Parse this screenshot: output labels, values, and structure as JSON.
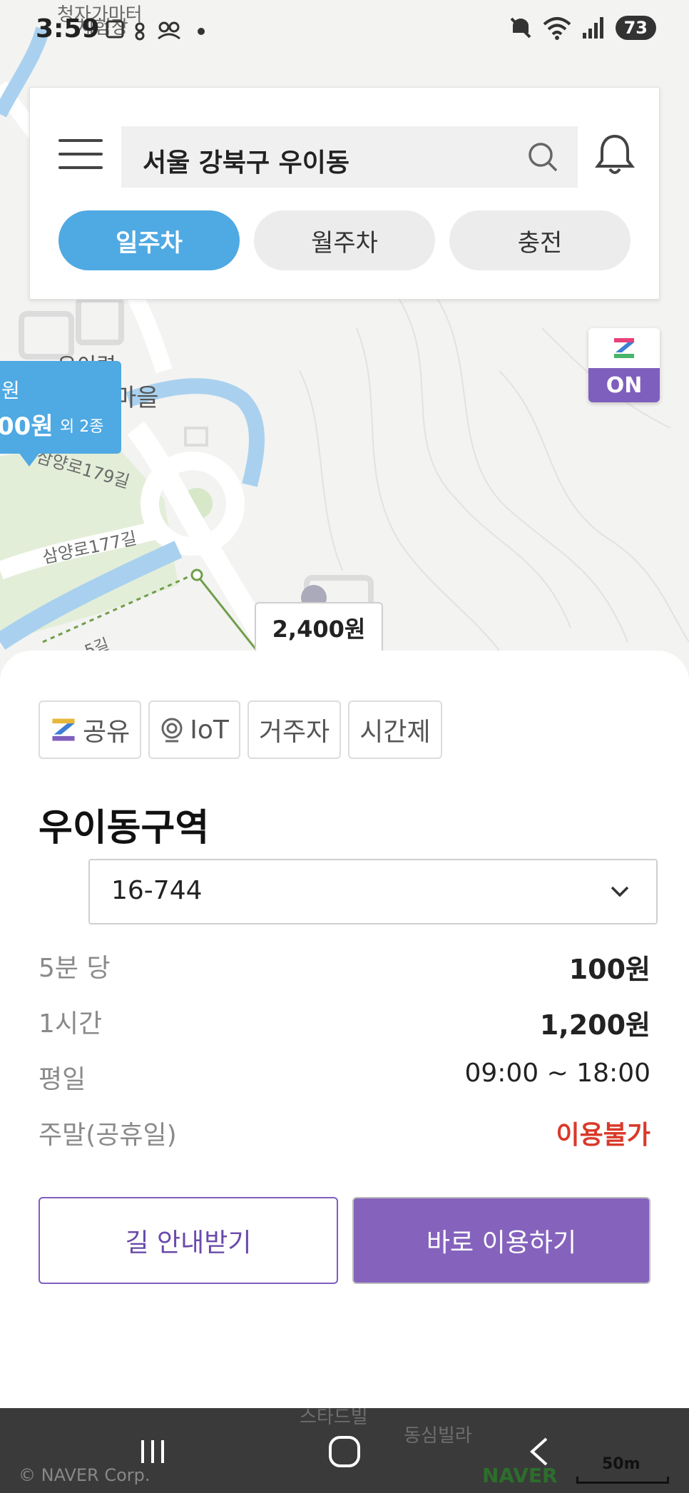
{
  "status_bar": {
    "time": "3:59",
    "battery": "73"
  },
  "map": {
    "labels": {
      "top_label_1": "청자가마터",
      "top_label_2": "체험장",
      "area_1": "우이령",
      "area_2": "마을",
      "road_1": "삼양로179길",
      "road_2": "삼양로177길",
      "road_3": "5길",
      "bottom_label_1": "스타드빌",
      "bottom_label_2": "동심빌라"
    },
    "bubble": {
      "line1": "원",
      "price": "00원",
      "extra": "외 2종"
    },
    "price_marker": "2,400원",
    "scale": "50m",
    "naver": "NAVER",
    "copyright": "© NAVER Corp."
  },
  "search": {
    "query": "서울 강북구 우이동",
    "tabs": [
      {
        "label": "일주차",
        "active": true
      },
      {
        "label": "월주차",
        "active": false
      },
      {
        "label": "충전",
        "active": false
      }
    ]
  },
  "zon_badge": {
    "label": "ON"
  },
  "sheet": {
    "tags": [
      "공유",
      "IoT",
      "거주자",
      "시간제"
    ],
    "zone_title": "우이동구역",
    "selected_lot": "16-744",
    "rows": [
      {
        "key": "5분 당",
        "value": "100원",
        "style": "bold"
      },
      {
        "key": "1시간",
        "value": "1,200원",
        "style": "bold"
      },
      {
        "key": "평일",
        "value": "09:00 ~ 18:00",
        "style": "normal"
      },
      {
        "key": "주말(공휴일)",
        "value": "이용불가",
        "style": "red"
      }
    ],
    "buttons": {
      "directions": "길 안내받기",
      "use_now": "바로 이용하기"
    }
  },
  "colors": {
    "accent_blue": "#4fa9e3",
    "accent_purple": "#8563bd",
    "unavailable_red": "#d93a2a"
  }
}
